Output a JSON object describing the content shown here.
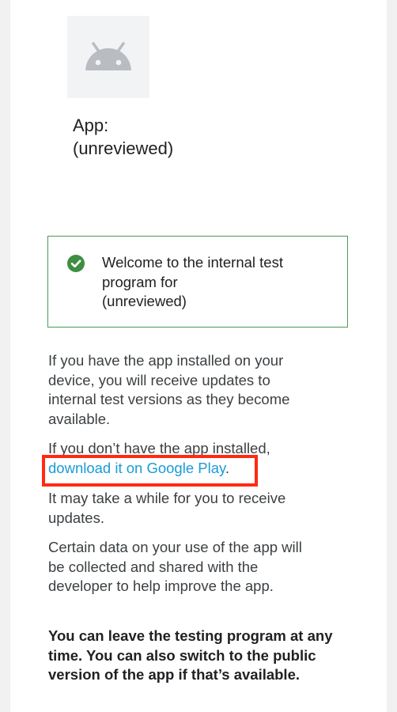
{
  "app": {
    "title_line1": "App:",
    "title_line2": "(unreviewed)",
    "icon": "android-robot-icon"
  },
  "welcome": {
    "line1": "Welcome to the internal test",
    "line2": "program for",
    "line3": "(unreviewed)",
    "icon": "check-circle-icon",
    "border_color": "#4a9a51",
    "icon_color": "#3e8e41"
  },
  "content": {
    "p1_line1": "If you have the app installed on your",
    "p1_line2": "device, you will receive updates to",
    "p1_line3": "internal test versions as they become",
    "p1_line4": "available.",
    "p2_line1": "If you don’t have the app installed,",
    "p2_link": "download it on Google Play",
    "p2_suffix": ".",
    "p3_line1": "It may take a while for you to receive",
    "p3_line2": "updates.",
    "p4_line1": "Certain data on your use of the app will",
    "p4_line2": "be collected and shared with the",
    "p4_line3": "developer to help improve the app.",
    "p5_line1": "You can leave the testing program at any",
    "p5_line2": "time. You can also switch to the public",
    "p5_line3": "version of the app if that’s available."
  },
  "colors": {
    "link": "#1a9bd7",
    "highlight": "#ff2a12",
    "background": "#f1f1f1"
  }
}
